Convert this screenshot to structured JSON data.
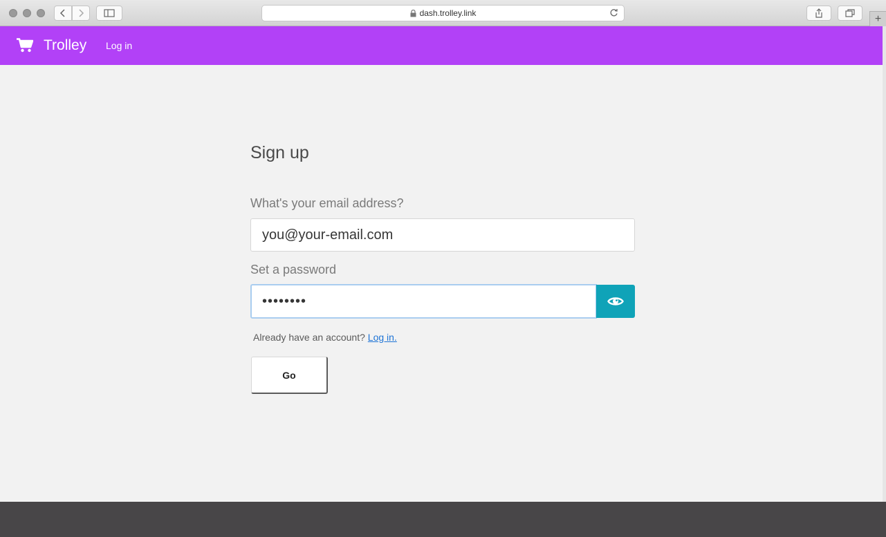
{
  "browser": {
    "url": "dash.trolley.link"
  },
  "navbar": {
    "brand": "Trolley",
    "login_link": "Log in",
    "color": "#b241f7"
  },
  "form": {
    "title": "Sign up",
    "email_label": "What's your email address?",
    "email_value": "you@your-email.com",
    "password_label": "Set a password",
    "password_value": "••••••••",
    "hint_text": "Already have an account?",
    "hint_link": "Log in.",
    "submit_label": "Go"
  },
  "icons": {
    "cart": "cart-icon",
    "eye": "eye-icon",
    "lock": "lock-icon",
    "reload": "reload-icon"
  },
  "colors": {
    "accent": "#b241f7",
    "toggle_button": "#0fa3b8",
    "link": "#1e74d6",
    "footer": "#484648"
  }
}
